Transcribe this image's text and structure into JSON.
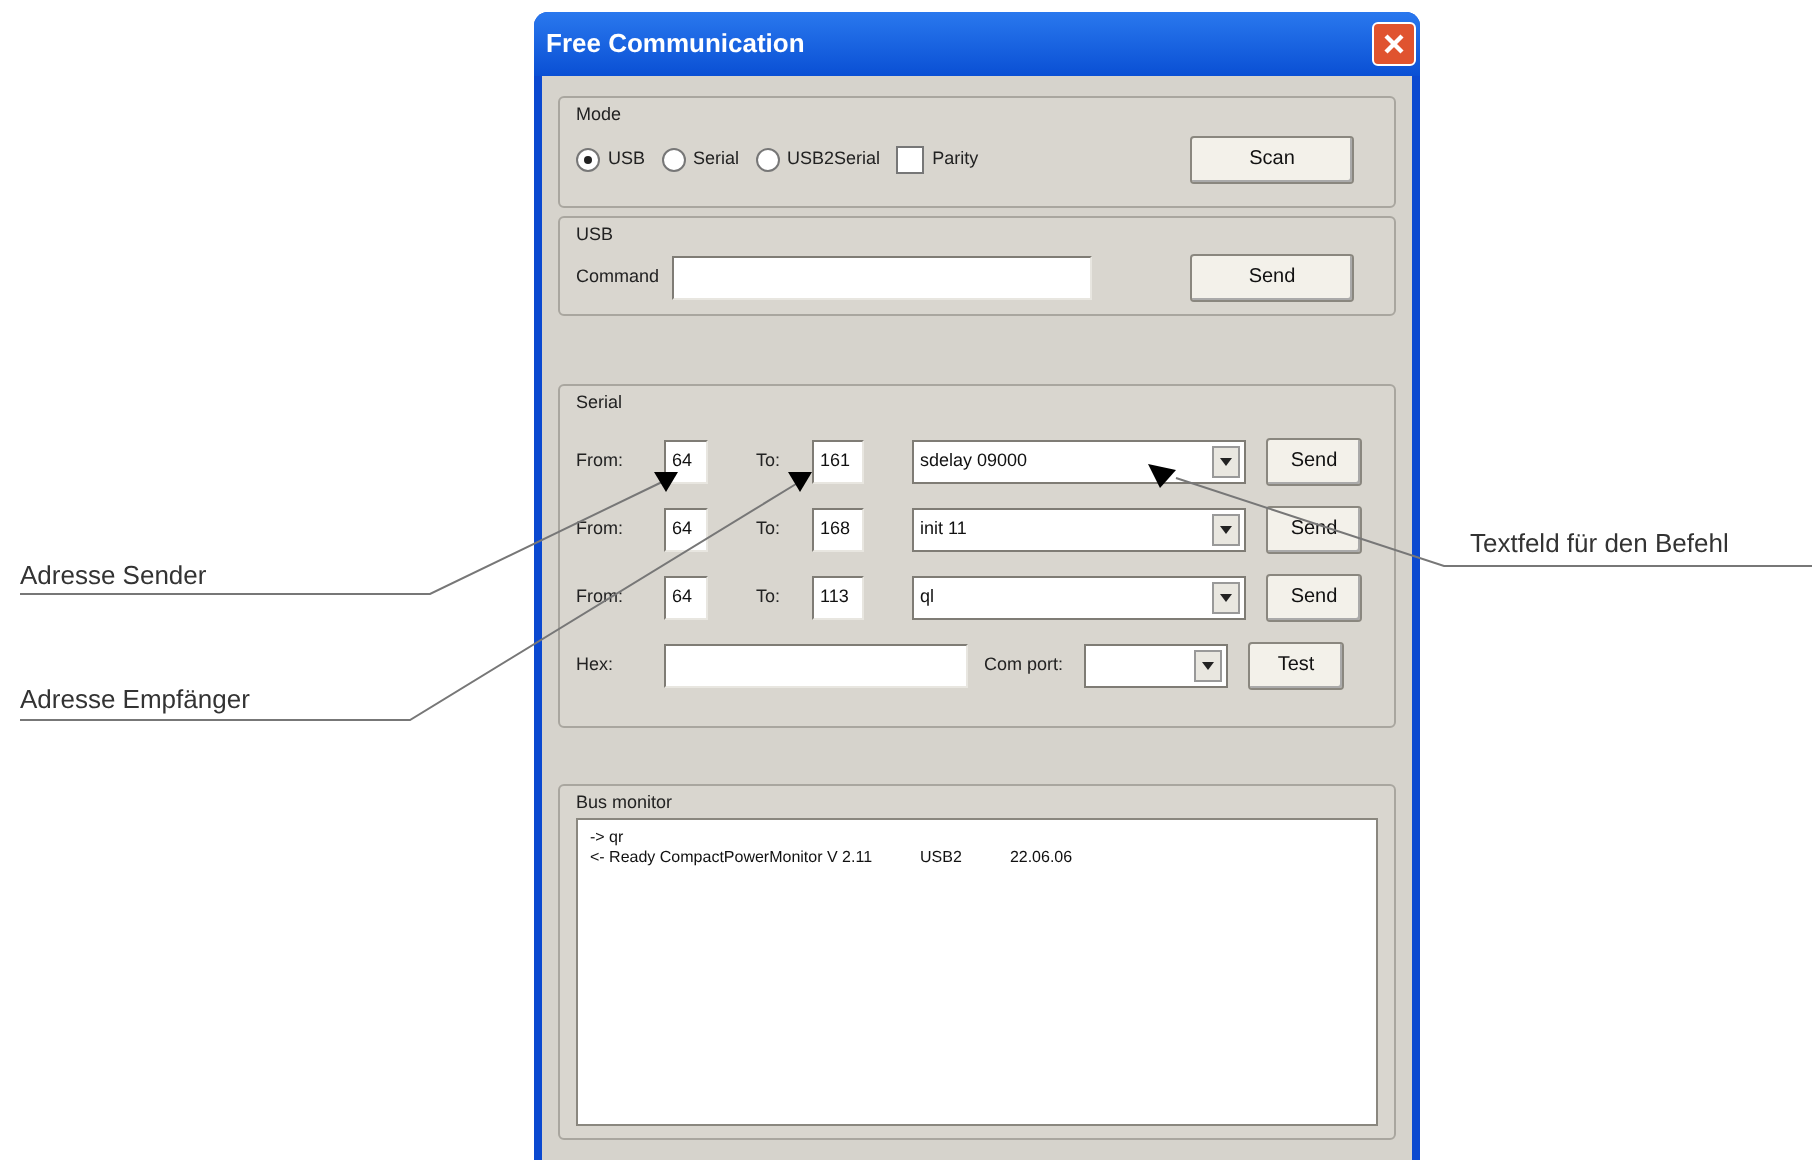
{
  "window": {
    "title": "Free Communication"
  },
  "mode": {
    "title": "Mode",
    "radios": [
      {
        "label": "USB",
        "selected": true
      },
      {
        "label": "Serial",
        "selected": false
      },
      {
        "label": "USB2Serial",
        "selected": false
      }
    ],
    "parity": {
      "label": "Parity",
      "checked": false
    },
    "scan_button": "Scan"
  },
  "usb": {
    "title": "USB",
    "command_label": "Command",
    "send_button": "Send"
  },
  "serial": {
    "title": "Serial",
    "rows": [
      {
        "from_label": "From:",
        "from": "64",
        "to_label": "To:",
        "to": "161",
        "command": "sdelay 09000",
        "send_button": "Send"
      },
      {
        "from_label": "From:",
        "from": "64",
        "to_label": "To:",
        "to": "168",
        "command": "init 11",
        "send_button": "Send"
      },
      {
        "from_label": "From:",
        "from": "64",
        "to_label": "To:",
        "to": "113",
        "command": "ql",
        "send_button": "Send"
      }
    ],
    "hex_label": "Hex:",
    "com_port_label": "Com port:",
    "test_button": "Test"
  },
  "bus_monitor": {
    "title": "Bus monitor",
    "lines": [
      {
        "parts": [
          "-> qr"
        ]
      },
      {
        "parts": [
          "<- Ready CompactPowerMonitor V 2.11",
          "USB2",
          "22.06.06"
        ]
      }
    ]
  },
  "annotations": [
    {
      "text": "Adresse Sender"
    },
    {
      "text": "Adresse Empfänger"
    },
    {
      "text": "Textfeld für den Befehl"
    }
  ]
}
